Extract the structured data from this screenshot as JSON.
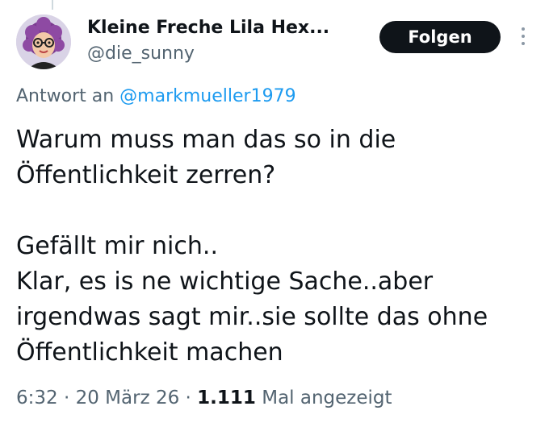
{
  "author": {
    "display_name": "Kleine Freche Lila Hex...",
    "handle": "@die_sunny",
    "avatar_icon": "avatar-icon"
  },
  "header": {
    "follow_label": "Folgen",
    "more_icon": "more-icon"
  },
  "reply": {
    "prefix": "Antwort an",
    "mention": "@markmueller1979"
  },
  "tweet": {
    "lines": [
      "Warum muss man das so in die",
      "Öffentlichkeit zerren?",
      "Gefällt mir nich..",
      "Klar, es is ne wichtige Sache..aber",
      "irgendwas sagt mir..sie sollte das ohne",
      "Öffentlichkeit machen"
    ]
  },
  "meta": {
    "time": "6:32",
    "separator": "·",
    "date": "20 März 26",
    "views_count": "1.111",
    "views_label": "Mal angezeigt"
  },
  "colors": {
    "text": "#0f1419",
    "secondary": "#536471",
    "link": "#1d9bf0",
    "follow_bg": "#0f1419"
  }
}
